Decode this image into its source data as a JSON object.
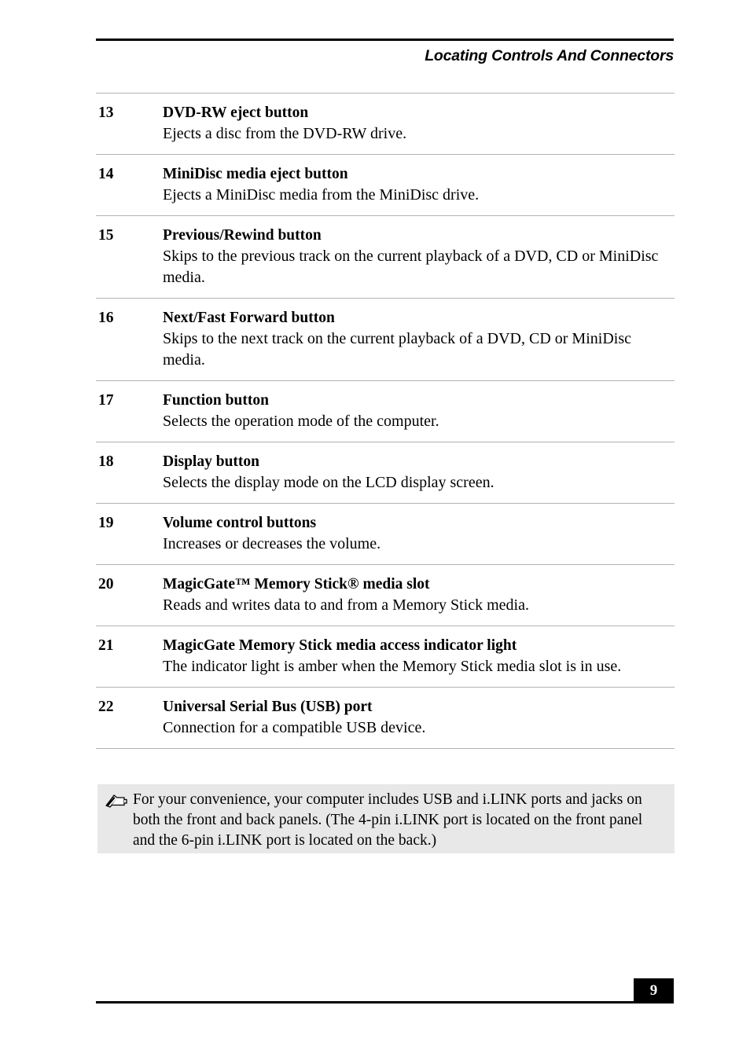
{
  "header": {
    "title": "Locating Controls And Connectors"
  },
  "items": [
    {
      "number": "13",
      "title": "DVD-RW eject button",
      "description": "Ejects a disc from the DVD-RW drive."
    },
    {
      "number": "14",
      "title": "MiniDisc media eject button",
      "description": "Ejects a MiniDisc media from the MiniDisc drive."
    },
    {
      "number": "15",
      "title": "Previous/Rewind button",
      "description": "Skips to the previous track on the current playback of a DVD, CD or MiniDisc media."
    },
    {
      "number": "16",
      "title": "Next/Fast Forward button",
      "description": "Skips to the next track on the current playback of a DVD, CD or MiniDisc media."
    },
    {
      "number": "17",
      "title": "Function button",
      "description": "Selects the operation mode of the computer."
    },
    {
      "number": "18",
      "title": "Display button",
      "description": "Selects the display mode on the LCD display screen."
    },
    {
      "number": "19",
      "title": "Volume control buttons",
      "description": "Increases or decreases the volume."
    },
    {
      "number": "20",
      "title": "MagicGate™ Memory Stick® media slot",
      "description": "Reads and writes data to and from a Memory Stick media."
    },
    {
      "number": "21",
      "title": "MagicGate Memory Stick media access indicator light",
      "description": "The indicator light is amber when the Memory Stick media slot is in use."
    },
    {
      "number": "22",
      "title": "Universal Serial Bus (USB) port",
      "description": "Connection for a compatible USB device."
    }
  ],
  "note": {
    "icon": "note-pencil-icon",
    "text": "For your convenience, your computer includes USB and i.LINK ports and jacks on both the front and back panels. (The 4-pin i.LINK port is located on the front panel and the 6-pin i.LINK port is located on the back.)",
    "background_color": "#e8e8e8"
  },
  "footer": {
    "page_number": "9",
    "page_number_background": "#000000",
    "page_number_color": "#ffffff"
  },
  "colors": {
    "rule": "#000000",
    "divider": "#b2b2b2",
    "text": "#000000",
    "page_background": "#ffffff"
  }
}
